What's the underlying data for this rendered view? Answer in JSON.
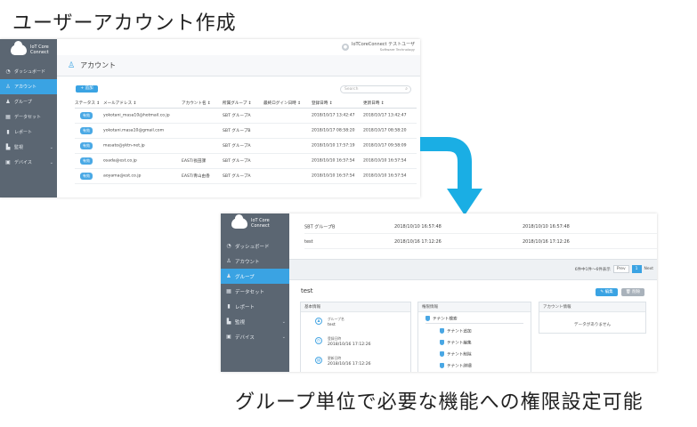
{
  "heading": "ユーザーアカウント作成",
  "caption": "グループ単位で必要な機能への権限設定可能",
  "colors": {
    "sidebar": "#5b6672",
    "accent": "#3aa3e3",
    "arrow": "#1aaee4"
  },
  "logo": {
    "line1": "IoT Core",
    "line2": "Connect"
  },
  "nav": [
    {
      "icon": "dashboard-icon",
      "glyph": "◔",
      "label": "ダッシュボード"
    },
    {
      "icon": "user-icon",
      "glyph": "♙",
      "label": "アカウント"
    },
    {
      "icon": "group-icon",
      "glyph": "♟",
      "label": "グループ"
    },
    {
      "icon": "dataset-icon",
      "glyph": "▦",
      "label": "データセット"
    },
    {
      "icon": "report-icon",
      "glyph": "▮",
      "label": "レポート"
    },
    {
      "icon": "monitor-icon",
      "glyph": "▙",
      "label": "監視"
    },
    {
      "icon": "device-icon",
      "glyph": "▣",
      "label": "デバイス"
    }
  ],
  "shot1": {
    "user_name": "IoTCoreConnect テストユーザ",
    "user_org": "Software Technology",
    "page_title": "アカウント",
    "add_label": "+ 追加",
    "search_placeholder": "Search",
    "columns": [
      "ステータス ↕",
      "メールアドレス ↕",
      "アカウント名 ↕",
      "所属グループ ↕",
      "最終ログイン日時 ↕",
      "登録日時 ↕",
      "更新日時 ↕"
    ],
    "rows": [
      {
        "status": "有効",
        "email": "yokotani_masa10@hotmail.co.jp",
        "account": "",
        "group": "SBT グループA",
        "last_login": "",
        "created": "2018/10/17 13:42:47",
        "updated": "2018/10/17 13:42:47"
      },
      {
        "status": "有効",
        "email": "yokotani.masa10@gmail.com",
        "account": "",
        "group": "SBT グループB",
        "last_login": "",
        "created": "2018/10/17 08:58:20",
        "updated": "2018/10/17 08:58:20"
      },
      {
        "status": "有効",
        "email": "masato@yktn-net.jp",
        "account": "",
        "group": "SBT グループA",
        "last_login": "",
        "created": "2018/10/10 17:57:19",
        "updated": "2018/10/17 09:58:09"
      },
      {
        "status": "有効",
        "email": "osada@est.co.jp",
        "account": "EAST/長田課",
        "group": "SBT グループA",
        "last_login": "",
        "created": "2018/10/10 16:57:54",
        "updated": "2018/10/10 16:57:54"
      },
      {
        "status": "有効",
        "email": "aoyama@est.co.jp",
        "account": "EAST/青山由香",
        "group": "SBT グループA",
        "last_login": "",
        "created": "2018/10/10 16:57:54",
        "updated": "2018/10/10 16:57:54"
      }
    ]
  },
  "shot2": {
    "list_rows": [
      {
        "name": "SBT グループB",
        "created": "2018/10/10 16:57:48",
        "updated": "2018/10/10 16:57:48"
      },
      {
        "name": "test",
        "created": "2018/10/16 17:12:26",
        "updated": "2018/10/16 17:12:26"
      }
    ],
    "pager_info": "6件中1件～6件表示",
    "prev": "Prev",
    "page": "1",
    "next": "Next",
    "detail_title": "test",
    "edit_label": "✎ 編集",
    "delete_label": "🗑 削除",
    "basic_panel": {
      "title": "基本情報",
      "items": [
        {
          "label": "グループ名",
          "value": "test"
        },
        {
          "label": "登録日時",
          "value": "2018/10/16 17:12:26"
        },
        {
          "label": "更新日時",
          "value": "2018/10/16 17:12:26"
        }
      ]
    },
    "perm_panel": {
      "title": "権限情報",
      "root": "テナント検索",
      "items": [
        "テナント追加",
        "テナント編集",
        "テナント削除",
        "テナント詳細"
      ]
    },
    "account_panel": {
      "title": "アカウント情報",
      "empty": "データがありません"
    }
  }
}
